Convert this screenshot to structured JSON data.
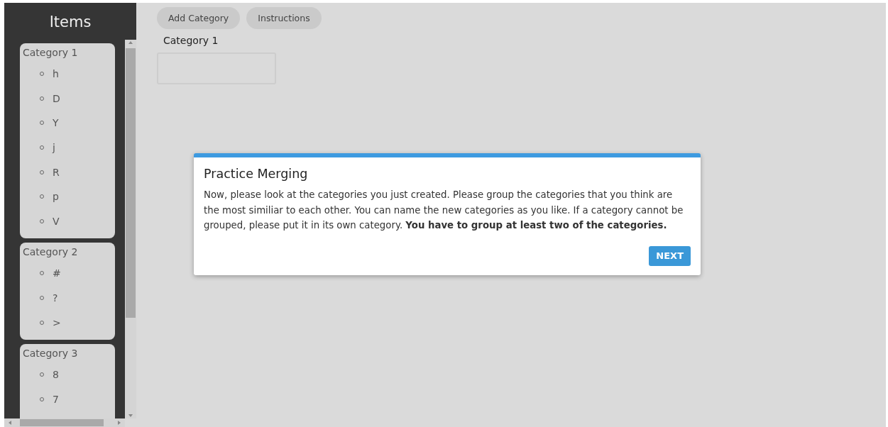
{
  "sidebar": {
    "title": "Items",
    "categories": [
      {
        "name": "Category 1",
        "items": [
          "h",
          "D",
          "Y",
          "j",
          "R",
          "p",
          "V"
        ]
      },
      {
        "name": "Category 2",
        "items": [
          "#",
          "?",
          ">"
        ]
      },
      {
        "name": "Category 3",
        "items": [
          "8",
          "7"
        ]
      }
    ]
  },
  "toolbar": {
    "buttons": [
      "Add Category",
      "Instructions"
    ]
  },
  "category_panel": {
    "title": "Category 1"
  },
  "dialog": {
    "title": "Practice Merging",
    "body": "Now, please look at the categories you just created. Please group the categories that you think are the most similiar to each other. You can name the new categories as you like. If a category cannot be grouped, please put it in its own category. **You have to group at least two of the categories.**",
    "button": "NEXT"
  }
}
